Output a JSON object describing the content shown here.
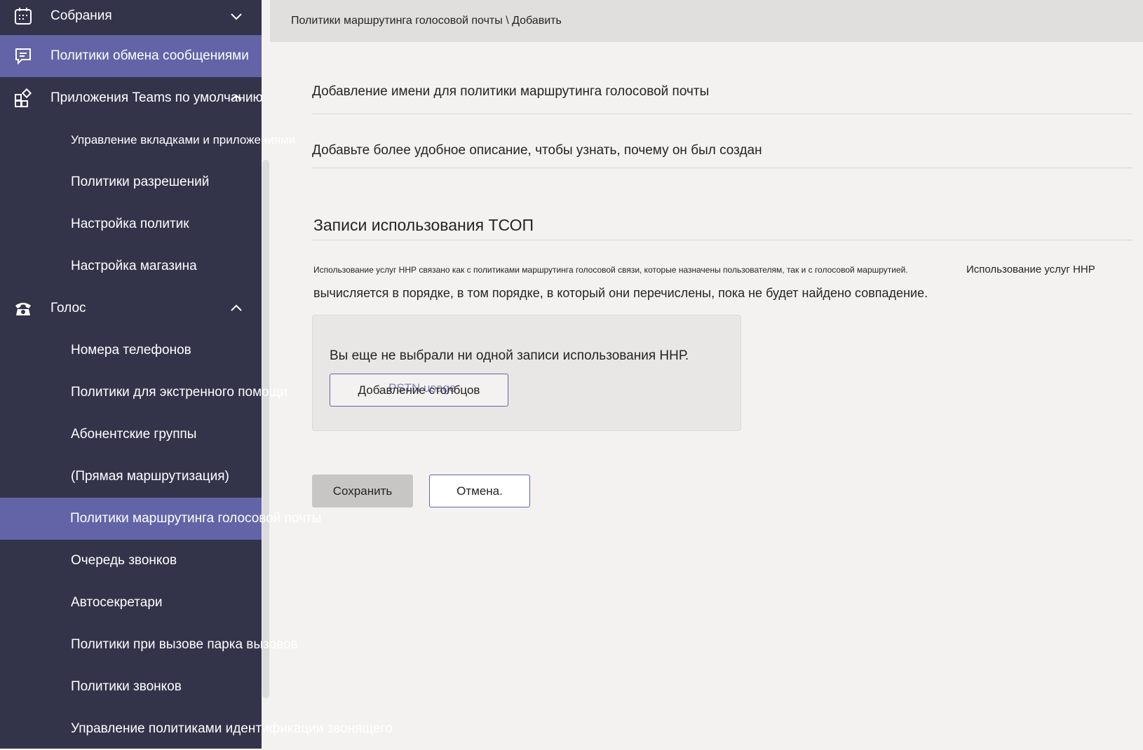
{
  "breadcrumb": "Политики маршрутинга голосовой почты \\ Добавить",
  "sidebar": {
    "items": [
      {
        "label": "Собрания",
        "icon": "calendar-icon",
        "chevron": "down"
      },
      {
        "label": "Политики обмена сообщениями",
        "icon": "chat-message-icon",
        "active": true
      },
      {
        "label": "Приложения Teams по умолчанию",
        "icon": "apps-icon",
        "chevron": "up"
      },
      {
        "label": "Управление вкладками и приложениями"
      },
      {
        "label": "Политики разрешений"
      },
      {
        "label": "Настройка политик"
      },
      {
        "label": "Настройка магазина"
      },
      {
        "label": "Голос",
        "icon": "phone-icon",
        "chevron": "up"
      },
      {
        "label": "Номера телефонов"
      },
      {
        "label": "Политики для экстренного помощи"
      },
      {
        "label": "Абонентские группы"
      },
      {
        "label": "(Прямая маршрутизация)"
      },
      {
        "label": "Политики маршрутинга голосовой почты",
        "active": true
      },
      {
        "label": "Очередь звонков"
      },
      {
        "label": "Автосекретари"
      },
      {
        "label": "Политики при вызове парка вызовов"
      },
      {
        "label": "Политики звонков"
      },
      {
        "label": "Управление политиками идентификации звонящего"
      }
    ]
  },
  "form": {
    "name_placeholder": "Добавление имени для политики маршрутинга голосовой почты",
    "description_placeholder": "Добавьте более удобное описание, чтобы узнать, почему он был создан",
    "pstn_title": "Записи использования ТСОП",
    "pstn_desc_small": "Использование услуг ННР связано как с политиками маршрутинга голосовой связи, которые назначены пользователям, так и с голосовой маршрутией.",
    "pstn_desc_small2": "Использование услуг ННР",
    "pstn_desc_line2": "вычисляется в порядке, в том порядке, в который они перечислены, пока не будет найдено совпадение.",
    "empty_text": "Вы еще не выбрали ни одной записи использования ННР.",
    "add_button": "Добавление столбцов",
    "add_button_ghost": "PSTN usage"
  },
  "actions": {
    "save": "Сохранить",
    "cancel": "Отмена."
  },
  "colors": {
    "sidebar_bg": "#33344a",
    "accent": "#6264a7",
    "page_bg": "#f3f2f1"
  }
}
